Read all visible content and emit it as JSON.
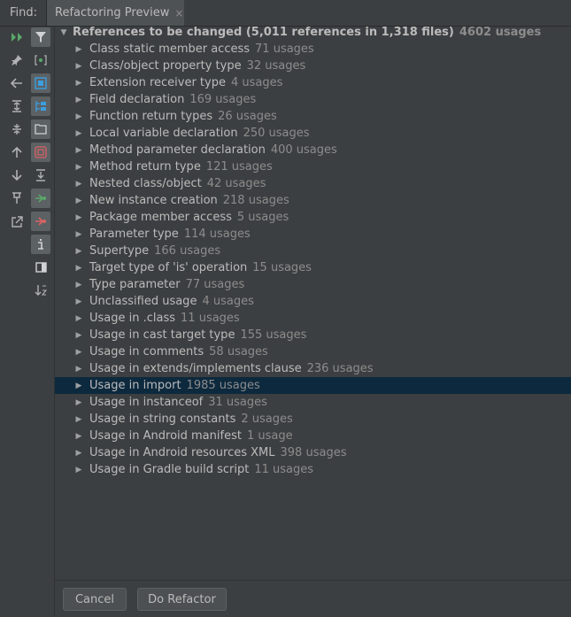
{
  "header": {
    "find_label": "Find:",
    "tab_label": "Refactoring Preview",
    "tab_close": "×"
  },
  "toolbar": {
    "items": [
      {
        "icon": "rerun-icon",
        "glyph": "▶▶"
      },
      {
        "icon": "filter-icon",
        "glyph": "▼"
      },
      {
        "icon": "pin-icon",
        "glyph": "✎"
      },
      {
        "icon": "group-by-module-icon",
        "glyph": "[•]"
      },
      {
        "icon": "back-icon",
        "glyph": "←"
      },
      {
        "icon": "group-by-package-icon",
        "glyph": "▣"
      },
      {
        "icon": "expand-all-icon",
        "glyph": "⇕"
      },
      {
        "icon": "group-by-directory-icon",
        "glyph": "▤"
      },
      {
        "icon": "collapse-all-icon",
        "glyph": "⇔"
      },
      {
        "icon": "group-by-file-icon",
        "glyph": "▦"
      },
      {
        "icon": "previous-occurrence-icon",
        "glyph": "↑"
      },
      {
        "icon": "file-structure-icon",
        "glyph": "⊻"
      },
      {
        "icon": "next-occurrence-icon",
        "glyph": "↓"
      },
      {
        "icon": "exclude-icon",
        "glyph": "⇥"
      },
      {
        "icon": "pin-tab-icon",
        "glyph": "⊤"
      },
      {
        "icon": "remove-icon",
        "glyph": "⇤"
      },
      {
        "icon": "export-icon",
        "glyph": "↗"
      },
      {
        "icon": "info-icon",
        "glyph": "i"
      },
      {
        "icon": "preview-icon",
        "glyph": "◨"
      },
      {
        "icon": "sort-icon",
        "glyph": "↓z"
      }
    ]
  },
  "tree": {
    "root": {
      "label": "References to be changed  (5,011 references in 1,318 files)",
      "count": "4602 usages"
    },
    "items": [
      {
        "label": "Class static member access",
        "count": "71 usages"
      },
      {
        "label": "Class/object property type",
        "count": "32 usages"
      },
      {
        "label": "Extension receiver type",
        "count": "4 usages"
      },
      {
        "label": "Field declaration",
        "count": "169 usages"
      },
      {
        "label": "Function return types",
        "count": "26 usages"
      },
      {
        "label": "Local variable declaration",
        "count": "250 usages"
      },
      {
        "label": "Method parameter declaration",
        "count": "400 usages"
      },
      {
        "label": "Method return type",
        "count": "121 usages"
      },
      {
        "label": "Nested class/object",
        "count": "42 usages"
      },
      {
        "label": "New instance creation",
        "count": "218 usages"
      },
      {
        "label": "Package member access",
        "count": "5 usages"
      },
      {
        "label": "Parameter type",
        "count": "114 usages"
      },
      {
        "label": "Supertype",
        "count": "166 usages"
      },
      {
        "label": "Target type of 'is' operation",
        "count": "15 usages"
      },
      {
        "label": "Type parameter",
        "count": "77 usages"
      },
      {
        "label": "Unclassified usage",
        "count": "4 usages"
      },
      {
        "label": "Usage in .class",
        "count": "11 usages"
      },
      {
        "label": "Usage in cast target type",
        "count": "155 usages"
      },
      {
        "label": "Usage in comments",
        "count": "58 usages"
      },
      {
        "label": "Usage in extends/implements clause",
        "count": "236 usages"
      },
      {
        "label": "Usage in import",
        "count": "1985 usages",
        "selected": true
      },
      {
        "label": "Usage in instanceof",
        "count": "31 usages"
      },
      {
        "label": "Usage in string constants",
        "count": "2 usages"
      },
      {
        "label": "Usage in Android manifest",
        "count": "1 usage"
      },
      {
        "label": "Usage in Android resources XML",
        "count": "398 usages"
      },
      {
        "label": "Usage in Gradle build script",
        "count": "11 usages"
      }
    ],
    "arrow_collapsed": "▶",
    "arrow_expanded": "▼"
  },
  "buttons": {
    "cancel": "Cancel",
    "do_refactor": "Do Refactor"
  },
  "colors": {
    "background": "#3c3f41",
    "selection": "#0d293e",
    "text": "#bbbbbb",
    "muted": "#8c8c8c",
    "accent_blue": "#3b9ee0",
    "accent_green": "#59a869"
  }
}
